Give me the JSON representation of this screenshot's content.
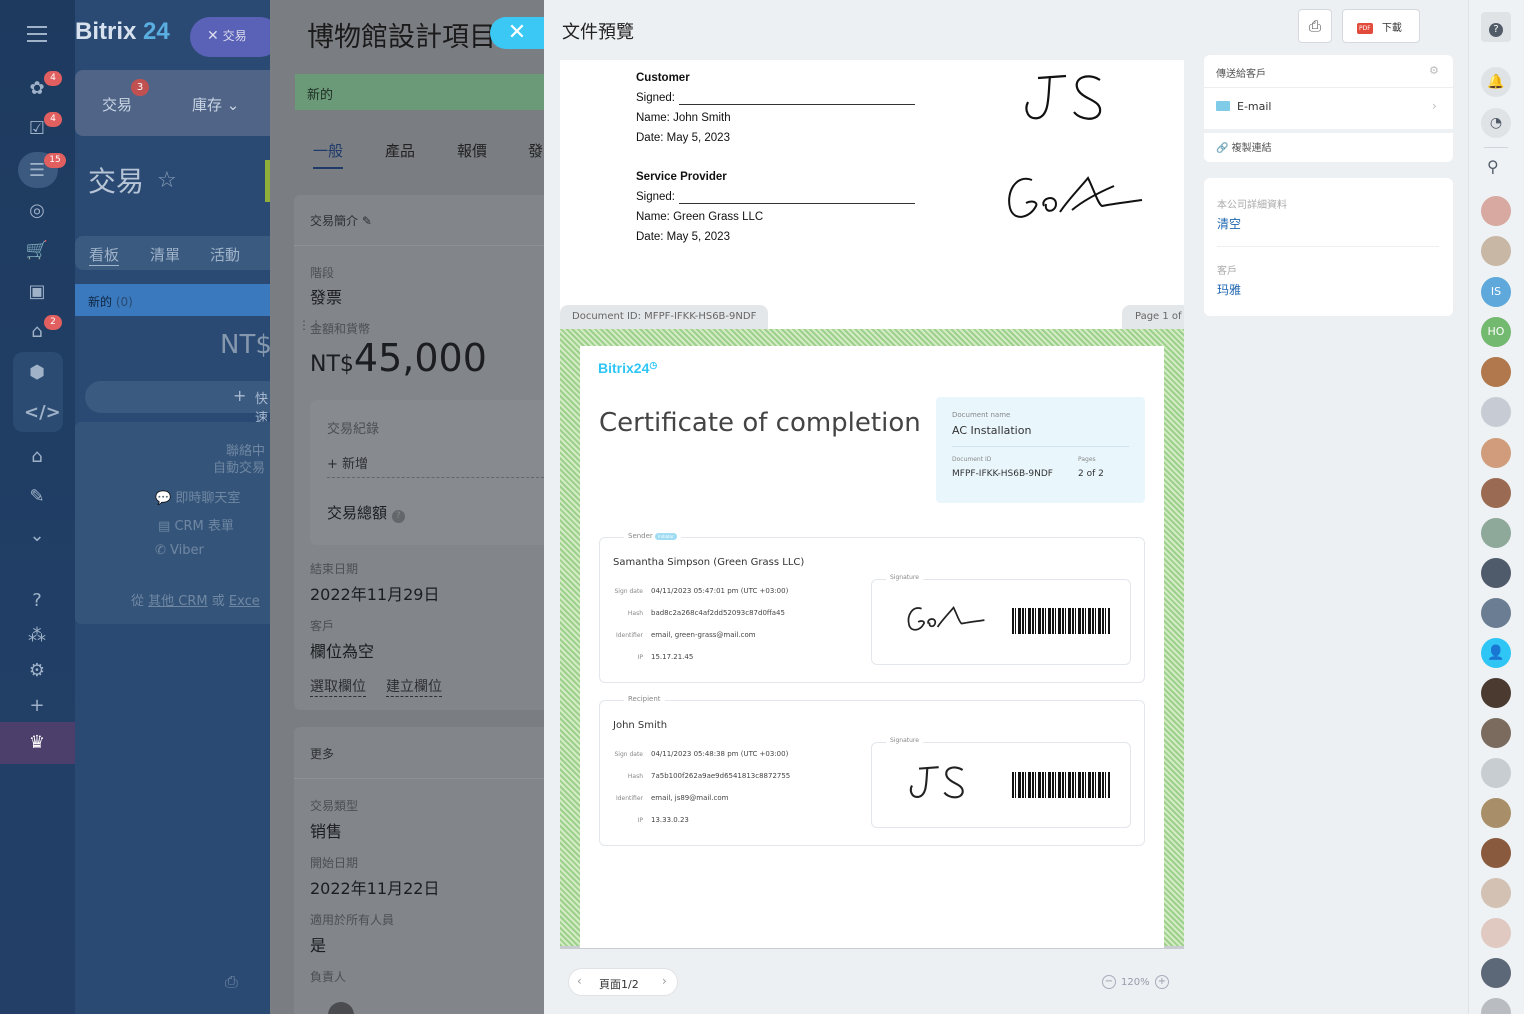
{
  "leftnav": {
    "logo": "Bitrix",
    "logo_num": "24",
    "chip_label": "交易",
    "badges": [
      "4",
      "4",
      "15",
      "2"
    ]
  },
  "crm": {
    "tab_deals": "交易",
    "tab_deals_badge": "3",
    "tab_inventory": "庫存",
    "page_title": "交易",
    "views": [
      "看板",
      "清單",
      "活動"
    ],
    "column_title": "新的",
    "column_count": "(0)",
    "column_sum": "NT$",
    "quick_add": "快速",
    "hint1": "聯絡中",
    "hint2": "自動交易",
    "channels": [
      "即時聊天室",
      "CRM 表單",
      "Viber"
    ],
    "import_text": "從",
    "import_link1": "其他 CRM",
    "import_or": "或",
    "import_link2": "Exce"
  },
  "deal": {
    "title": "博物館設計項目",
    "stage_bar": "新的",
    "tabs": [
      "一般",
      "產品",
      "報價",
      "發"
    ],
    "section_about": "交易簡介",
    "stage_label": "階段",
    "stage_value": "發票",
    "amount_label": "金額和貨幣",
    "amount_currency": "NT$",
    "amount_value": "45,000",
    "history_label": "交易紀錄",
    "history_add": "+ 新增",
    "summary_label": "交易總額",
    "end_date_label": "結束日期",
    "end_date_value": "2022年11月29日",
    "client_label": "客戶",
    "client_value": "欄位為空",
    "select_field": "選取欄位",
    "create_field": "建立欄位",
    "more_label": "更多",
    "type_label": "交易類型",
    "type_value": "销售",
    "start_label": "開始日期",
    "start_value": "2022年11月22日",
    "available_label": "適用於所有人員",
    "available_value": "是",
    "responsible_label": "負責人"
  },
  "preview": {
    "title": "文件預覽",
    "download": "下載",
    "pdf_badge": "PDF",
    "page1": {
      "customer_heading": "Customer",
      "signed_label": "Signed:",
      "customer_name": "Name: John Smith",
      "customer_date": "Date: May 5, 2023",
      "provider_heading": "Service Provider",
      "provider_name": "Name: Green Grass LLC",
      "provider_date": "Date: May 5, 2023",
      "doc_id_tag": "Document ID: MFPF-IFKK-HS6B-9NDF",
      "page_tag": "Page 1 of"
    },
    "certificate": {
      "brand": "Bitrix24",
      "title": "Certificate of completion",
      "doc_name_label": "Document name",
      "doc_name": "AC Installation",
      "doc_id_label": "Document ID",
      "doc_id": "MFPF-IFKK-HS6B-9NDF",
      "pages_label": "Pages",
      "pages": "2 of 2",
      "sender_label": "Sender",
      "sender_badge": "Initiator",
      "sender_name": "Samantha Simpson (Green Grass LLC)",
      "sender_rows": [
        {
          "k": "Sign date",
          "v": "04/11/2023 05:47:01 pm (UTC +03:00)"
        },
        {
          "k": "Hash",
          "v": "bad8c2a268c4af2dd52093c87d0ffa45"
        },
        {
          "k": "Identifier",
          "v": "email, green-grass@mail.com"
        },
        {
          "k": "IP",
          "v": "15.17.21.45"
        }
      ],
      "signature_label": "Signature",
      "recipient_label": "Recipient",
      "recipient_name": "John Smith",
      "recipient_rows": [
        {
          "k": "Sign date",
          "v": "04/11/2023 05:48:38 pm (UTC +03:00)"
        },
        {
          "k": "Hash",
          "v": "7a5b100f262a9ae9d6541813c8872755"
        },
        {
          "k": "Identifier",
          "v": "email, js89@mail.com"
        },
        {
          "k": "IP",
          "v": "13.33.0.23"
        }
      ]
    },
    "pager": "頁面1/2",
    "zoom": "120%"
  },
  "sidepanel": {
    "send_title": "傳送給客戶",
    "email": "E-mail",
    "copy_link": "複製連結",
    "company_label": "本公司詳細資料",
    "company_value": "清空",
    "client_label": "客戶",
    "client_value": "玛雅"
  },
  "rightbar": {
    "avatar_is": "IS",
    "avatar_ho": "HO"
  }
}
